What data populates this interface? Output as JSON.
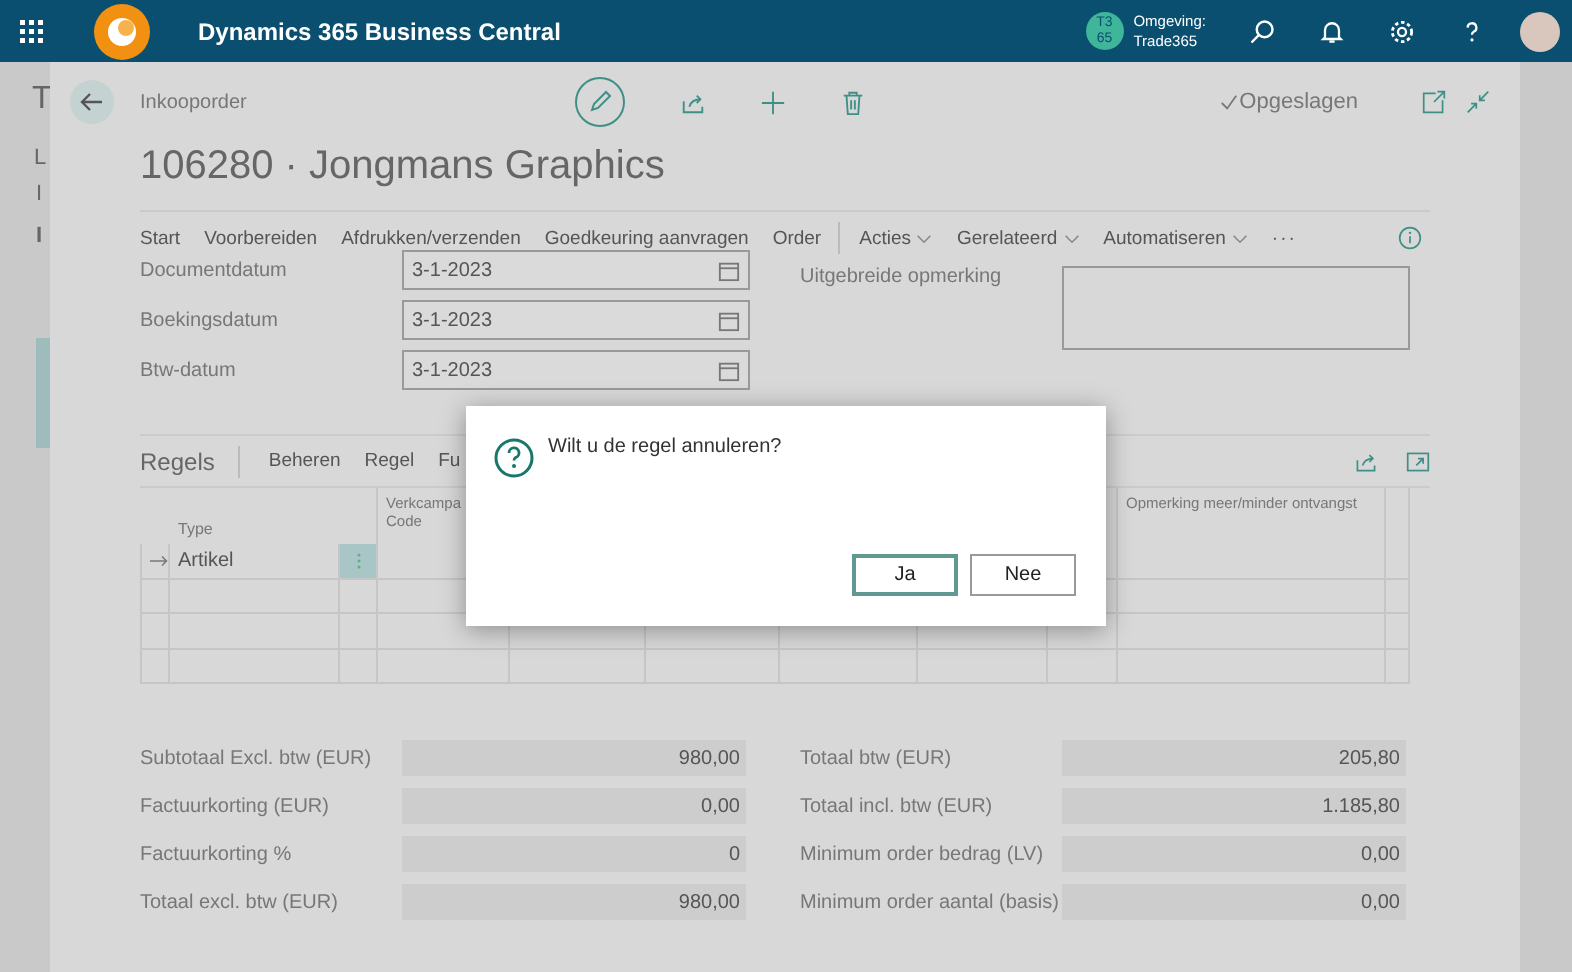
{
  "top_bar": {
    "app_title": "Dynamics 365 Business Central",
    "environment_badge": "T3 65",
    "environment_label": "Omgeving:",
    "environment_name": "Trade365"
  },
  "background_page": {
    "fragments": [
      "T",
      "L",
      "I",
      "I"
    ]
  },
  "page": {
    "breadcrumb": "Inkooporder",
    "title": "106280 · Jongmans Graphics",
    "save_status": "Opgeslagen",
    "actions": [
      "Start",
      "Voorbereiden",
      "Afdrukken/verzenden",
      "Goedkeuring aanvragen",
      "Order"
    ],
    "menus": [
      "Acties",
      "Gerelateerd",
      "Automatiseren"
    ],
    "more": "···",
    "date_fields": [
      {
        "label": "Documentdatum",
        "value": "3-1-2023"
      },
      {
        "label": "Boekingsdatum",
        "value": "3-1-2023"
      },
      {
        "label": "Btw-datum",
        "value": "3-1-2023"
      }
    ],
    "remark_label": "Uitgebreide opmerking",
    "lines": {
      "title": "Regels",
      "actions": [
        "Beheren",
        "Regel",
        "Fu"
      ],
      "columns": [
        {
          "label": "Type"
        },
        {
          "label": "Verkcampa Code"
        },
        {
          "label": "Opmerking meer/minder ontvangst"
        }
      ],
      "rows": [
        {
          "selected": true,
          "type": "Artikel"
        },
        {
          "selected": false,
          "type": ""
        },
        {
          "selected": false,
          "type": ""
        },
        {
          "selected": false,
          "type": ""
        }
      ]
    },
    "totals_left": [
      {
        "label": "Subtotaal Excl. btw (EUR)",
        "value": "980,00"
      },
      {
        "label": "Factuurkorting (EUR)",
        "value": "0,00"
      },
      {
        "label": "Factuurkorting %",
        "value": "0"
      },
      {
        "label": "Totaal excl. btw (EUR)",
        "value": "980,00"
      }
    ],
    "totals_right": [
      {
        "label": "Totaal btw (EUR)",
        "value": "205,80"
      },
      {
        "label": "Totaal incl. btw (EUR)",
        "value": "1.185,80"
      },
      {
        "label": "Minimum order bedrag (LV)",
        "value": "0,00"
      },
      {
        "label": "Minimum order aantal (basis)",
        "value": "0,00"
      }
    ]
  },
  "dialog": {
    "message": "Wilt u de regel annuleren?",
    "buttons": [
      {
        "label": "Ja",
        "selected": true
      },
      {
        "label": "Nee",
        "selected": false
      }
    ]
  }
}
